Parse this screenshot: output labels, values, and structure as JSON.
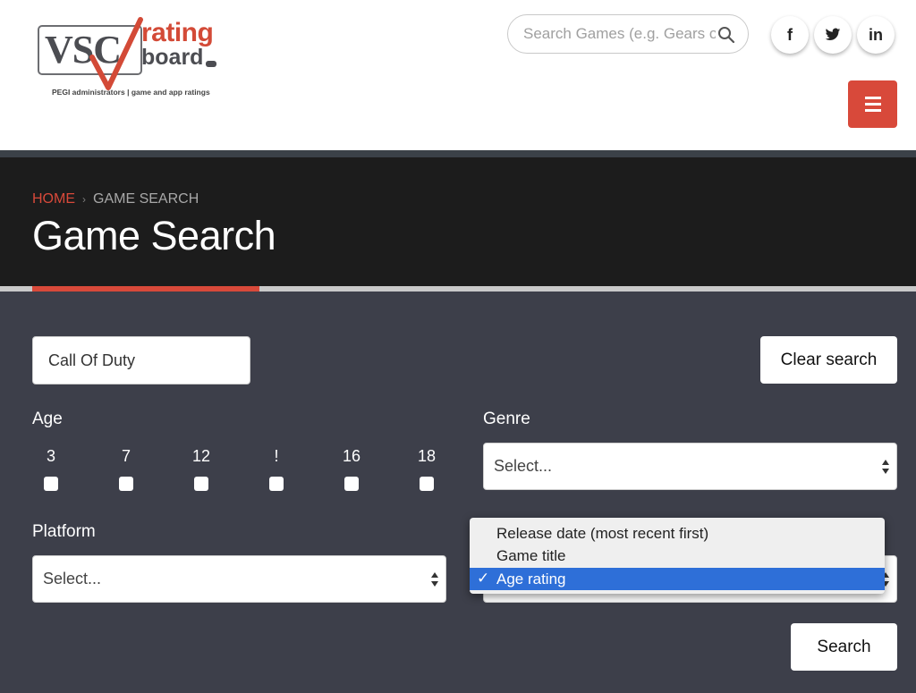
{
  "header": {
    "logo": {
      "vsc": "VSC",
      "rating": "rating",
      "board": "board",
      "tagline": "PEGI administrators  |  game and app ratings"
    },
    "search_placeholder": "Search Games (e.g. Gears of War)",
    "social": {
      "facebook": "f",
      "twitter": "twitter",
      "linkedin": "in"
    }
  },
  "breadcrumb": {
    "home": "HOME",
    "separator": "›",
    "current": "GAME SEARCH"
  },
  "page_title": "Game Search",
  "form": {
    "query_value": "Call Of Duty",
    "clear_label": "Clear search",
    "age_label": "Age",
    "ages": [
      "3",
      "7",
      "12",
      "!",
      "16",
      "18"
    ],
    "genre_label": "Genre",
    "genre_value": "Select...",
    "platform_label": "Platform",
    "platform_value": "Select...",
    "sort_options": [
      "Release date (most recent first)",
      "Game title",
      "Age rating"
    ],
    "sort_selected": "Age rating",
    "search_label": "Search"
  },
  "colors": {
    "accent": "#d8493a",
    "selected_option": "#2e6fd8",
    "panel": "#3d3f4a",
    "banner": "#1c1c1c"
  }
}
